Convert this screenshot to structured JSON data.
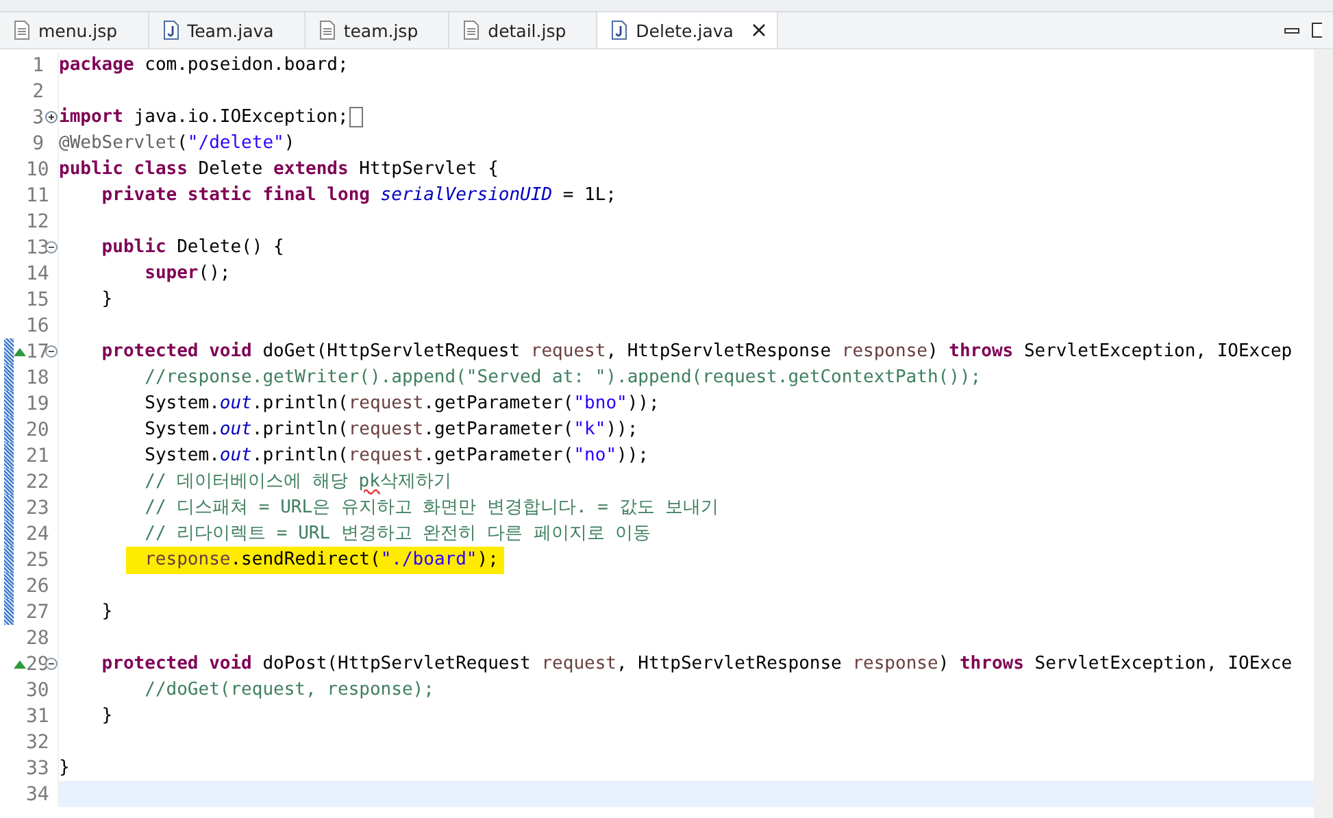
{
  "tabs": [
    {
      "label": "menu.jsp",
      "kind": "jsp",
      "selected": false
    },
    {
      "label": "Team.java",
      "kind": "java",
      "selected": false
    },
    {
      "label": "team.jsp",
      "kind": "jsp",
      "selected": false
    },
    {
      "label": "detail.jsp",
      "kind": "jsp",
      "selected": false
    },
    {
      "label": "Delete.java",
      "kind": "java",
      "selected": true
    }
  ],
  "editor": {
    "lines": [
      {
        "number": "1",
        "segments": [
          {
            "kind": "keyword",
            "text": "package"
          },
          {
            "kind": "plain",
            "text": " com.poseidon.board;"
          }
        ]
      },
      {
        "number": "2"
      },
      {
        "number": "3",
        "fold": {
          "expanded": false
        },
        "folded_marker": true,
        "segments": [
          {
            "kind": "keyword",
            "text": "import"
          },
          {
            "kind": "plain",
            "text": " java.io.IOException;"
          }
        ]
      },
      {
        "number": "9",
        "segments": [
          {
            "kind": "annotation",
            "text": "@WebServlet"
          },
          {
            "kind": "plain",
            "text": "("
          },
          {
            "kind": "string",
            "text": "\"/delete\""
          },
          {
            "kind": "plain",
            "text": ")"
          }
        ]
      },
      {
        "number": "10",
        "segments": [
          {
            "kind": "keyword",
            "text": "public class"
          },
          {
            "kind": "plain",
            "text": " Delete "
          },
          {
            "kind": "keyword",
            "text": "extends"
          },
          {
            "kind": "plain",
            "text": " HttpServlet {"
          }
        ]
      },
      {
        "number": "11",
        "segments": [
          {
            "kind": "keyword",
            "text": "    private static final long"
          },
          {
            "kind": "field",
            "text": " serialVersionUID"
          },
          {
            "kind": "plain",
            "text": " = 1L;"
          }
        ]
      },
      {
        "number": "12"
      },
      {
        "number": "13",
        "fold": {
          "expanded": true
        },
        "segments": [
          {
            "kind": "keyword",
            "text": "    public"
          },
          {
            "kind": "plain",
            "text": " Delete() {"
          }
        ]
      },
      {
        "number": "14",
        "segments": [
          {
            "kind": "keyword",
            "text": "        super"
          },
          {
            "kind": "plain",
            "text": "();"
          }
        ]
      },
      {
        "number": "15",
        "segments": [
          {
            "kind": "plain",
            "text": "    }"
          }
        ]
      },
      {
        "number": "16"
      },
      {
        "number": "17",
        "fold": {
          "expanded": true
        },
        "override": true,
        "changed": true,
        "segments": [
          {
            "kind": "keyword",
            "text": "    protected void"
          },
          {
            "kind": "plain",
            "text": " doGet(HttpServletRequest "
          },
          {
            "kind": "param",
            "text": "request"
          },
          {
            "kind": "plain",
            "text": ", HttpServletResponse "
          },
          {
            "kind": "param",
            "text": "response"
          },
          {
            "kind": "plain",
            "text": ") "
          },
          {
            "kind": "keyword",
            "text": "throws"
          },
          {
            "kind": "plain",
            "text": " ServletException, IOExcep"
          }
        ]
      },
      {
        "number": "18",
        "changed": true,
        "segments": [
          {
            "kind": "comment",
            "text": "        //response.getWriter().append(\"Served at: \").append(request.getContextPath());"
          }
        ]
      },
      {
        "number": "19",
        "changed": true,
        "segments": [
          {
            "kind": "plain",
            "text": "        System."
          },
          {
            "kind": "static",
            "text": "out"
          },
          {
            "kind": "plain",
            "text": ".println("
          },
          {
            "kind": "param",
            "text": "request"
          },
          {
            "kind": "plain",
            "text": ".getParameter("
          },
          {
            "kind": "string",
            "text": "\"bno\""
          },
          {
            "kind": "plain",
            "text": "));"
          }
        ]
      },
      {
        "number": "20",
        "changed": true,
        "segments": [
          {
            "kind": "plain",
            "text": "        System."
          },
          {
            "kind": "static",
            "text": "out"
          },
          {
            "kind": "plain",
            "text": ".println("
          },
          {
            "kind": "param",
            "text": "request"
          },
          {
            "kind": "plain",
            "text": ".getParameter("
          },
          {
            "kind": "string",
            "text": "\"k\""
          },
          {
            "kind": "plain",
            "text": "));"
          }
        ]
      },
      {
        "number": "21",
        "changed": true,
        "segments": [
          {
            "kind": "plain",
            "text": "        System."
          },
          {
            "kind": "static",
            "text": "out"
          },
          {
            "kind": "plain",
            "text": ".println("
          },
          {
            "kind": "param",
            "text": "request"
          },
          {
            "kind": "plain",
            "text": ".getParameter("
          },
          {
            "kind": "string",
            "text": "\"no\""
          },
          {
            "kind": "plain",
            "text": "));"
          }
        ]
      },
      {
        "number": "22",
        "changed": true,
        "segments": [
          {
            "kind": "comment",
            "text": "        // 데이터베이스에 해당 "
          },
          {
            "kind": "misspelled",
            "text": "pk"
          },
          {
            "kind": "comment",
            "text": "삭제하기"
          }
        ]
      },
      {
        "number": "23",
        "changed": true,
        "segments": [
          {
            "kind": "comment",
            "text": "        // 디스패쳐 = URL은 유지하고 화면만 변경합니다. = 값도 보내기"
          }
        ]
      },
      {
        "number": "24",
        "changed": true,
        "segments": [
          {
            "kind": "comment",
            "text": "        // 리다이렉트 = URL 변경하고 완전히 다른 페이지로 이동"
          }
        ]
      },
      {
        "number": "25",
        "changed": true,
        "highlighted": true,
        "segments": [
          {
            "kind": "param",
            "text": "response"
          },
          {
            "kind": "plain",
            "text": ".sendRedirect("
          },
          {
            "kind": "string",
            "text": "\"./board\""
          },
          {
            "kind": "plain",
            "text": ");"
          }
        ]
      },
      {
        "number": "26",
        "changed": true
      },
      {
        "number": "27",
        "changed": true,
        "segments": [
          {
            "kind": "plain",
            "text": "    }"
          }
        ]
      },
      {
        "number": "28"
      },
      {
        "number": "29",
        "fold": {
          "expanded": true
        },
        "override": true,
        "segments": [
          {
            "kind": "keyword",
            "text": "    protected void"
          },
          {
            "kind": "plain",
            "text": " doPost(HttpServletRequest "
          },
          {
            "kind": "param",
            "text": "request"
          },
          {
            "kind": "plain",
            "text": ", HttpServletResponse "
          },
          {
            "kind": "param",
            "text": "response"
          },
          {
            "kind": "plain",
            "text": ") "
          },
          {
            "kind": "keyword",
            "text": "throws"
          },
          {
            "kind": "plain",
            "text": " ServletException, IOExce"
          }
        ]
      },
      {
        "number": "30",
        "segments": [
          {
            "kind": "comment",
            "text": "        //doGet(request, response);"
          }
        ]
      },
      {
        "number": "31",
        "segments": [
          {
            "kind": "plain",
            "text": "    }"
          }
        ]
      },
      {
        "number": "32"
      },
      {
        "number": "33",
        "segments": [
          {
            "kind": "plain",
            "text": "}"
          }
        ]
      },
      {
        "number": "34",
        "current": true
      }
    ]
  }
}
